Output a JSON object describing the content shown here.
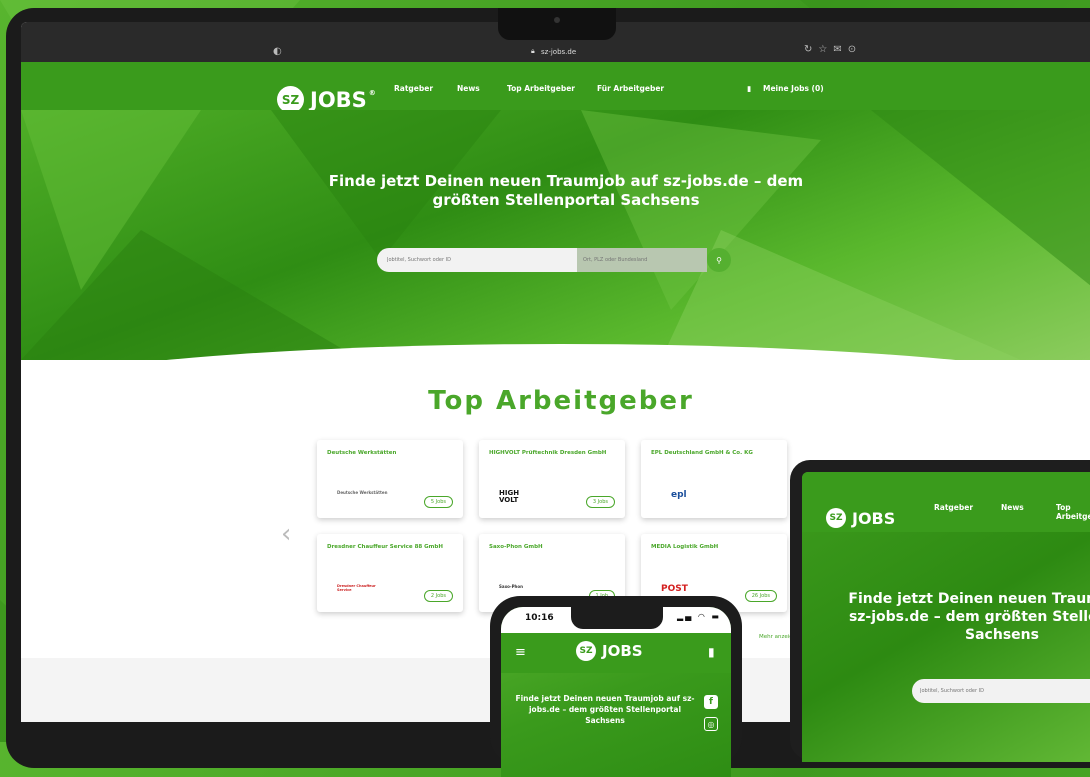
{
  "browser": {
    "url": "sz-jobs.de"
  },
  "site": {
    "logo_badge": "SZ",
    "logo_text": "JOBS",
    "logo_reg": "®",
    "nav": [
      "Ratgeber",
      "News",
      "Top Arbeitgeber",
      "Für Arbeitgeber"
    ],
    "my_jobs": "Meine Jobs (0)"
  },
  "hero": {
    "title": "Finde jetzt Deinen neuen Traumjob auf sz-jobs.de – dem größten Stellenportal Sachsens",
    "search_placeholder": "Jobtitel, Suchwort oder ID",
    "location_placeholder": "Ort, PLZ oder Bundesland"
  },
  "employers": {
    "title": "Top Arbeitgeber",
    "more": "Mehr anzeigen",
    "cards": [
      {
        "name": "Deutsche Werkstätten",
        "logo": "Deutsche Werkstätten",
        "jobs": "5 Jobs"
      },
      {
        "name": "HIGHVOLT Prüftechnik Dresden GmbH",
        "logo": "HIGH VOLT",
        "jobs": "3 Jobs"
      },
      {
        "name": "EPL Deutschland GmbH & Co. KG",
        "logo": "epl",
        "jobs": ""
      },
      {
        "name": "Dresdner Chauffeur Service 88 GmbH",
        "logo": "Dresdner Chauffeur Service",
        "jobs": "2 Jobs"
      },
      {
        "name": "Saxo-Phon GmbH",
        "logo": "Saxo-Phon",
        "jobs": "1 Job"
      },
      {
        "name": "MEDIA Logistik GmbH",
        "logo": "POST",
        "jobs": "26 Jobs"
      }
    ]
  },
  "tablet": {
    "nav": [
      "Ratgeber",
      "News",
      "Top Arbeitgeber"
    ],
    "title": "Finde jetzt Deinen neuen Traumjob auf sz-jobs.de – dem größten Stellenportal Sachsens",
    "search_placeholder": "Jobtitel, Suchwort oder ID"
  },
  "phone": {
    "time": "10:16",
    "title": "Finde jetzt Deinen neuen Traumjob auf sz-jobs.de – dem größten Stellenportal Sachsens"
  },
  "colors": {
    "brand_green": "#3a9b1c",
    "accent_green": "#4aa72a"
  }
}
